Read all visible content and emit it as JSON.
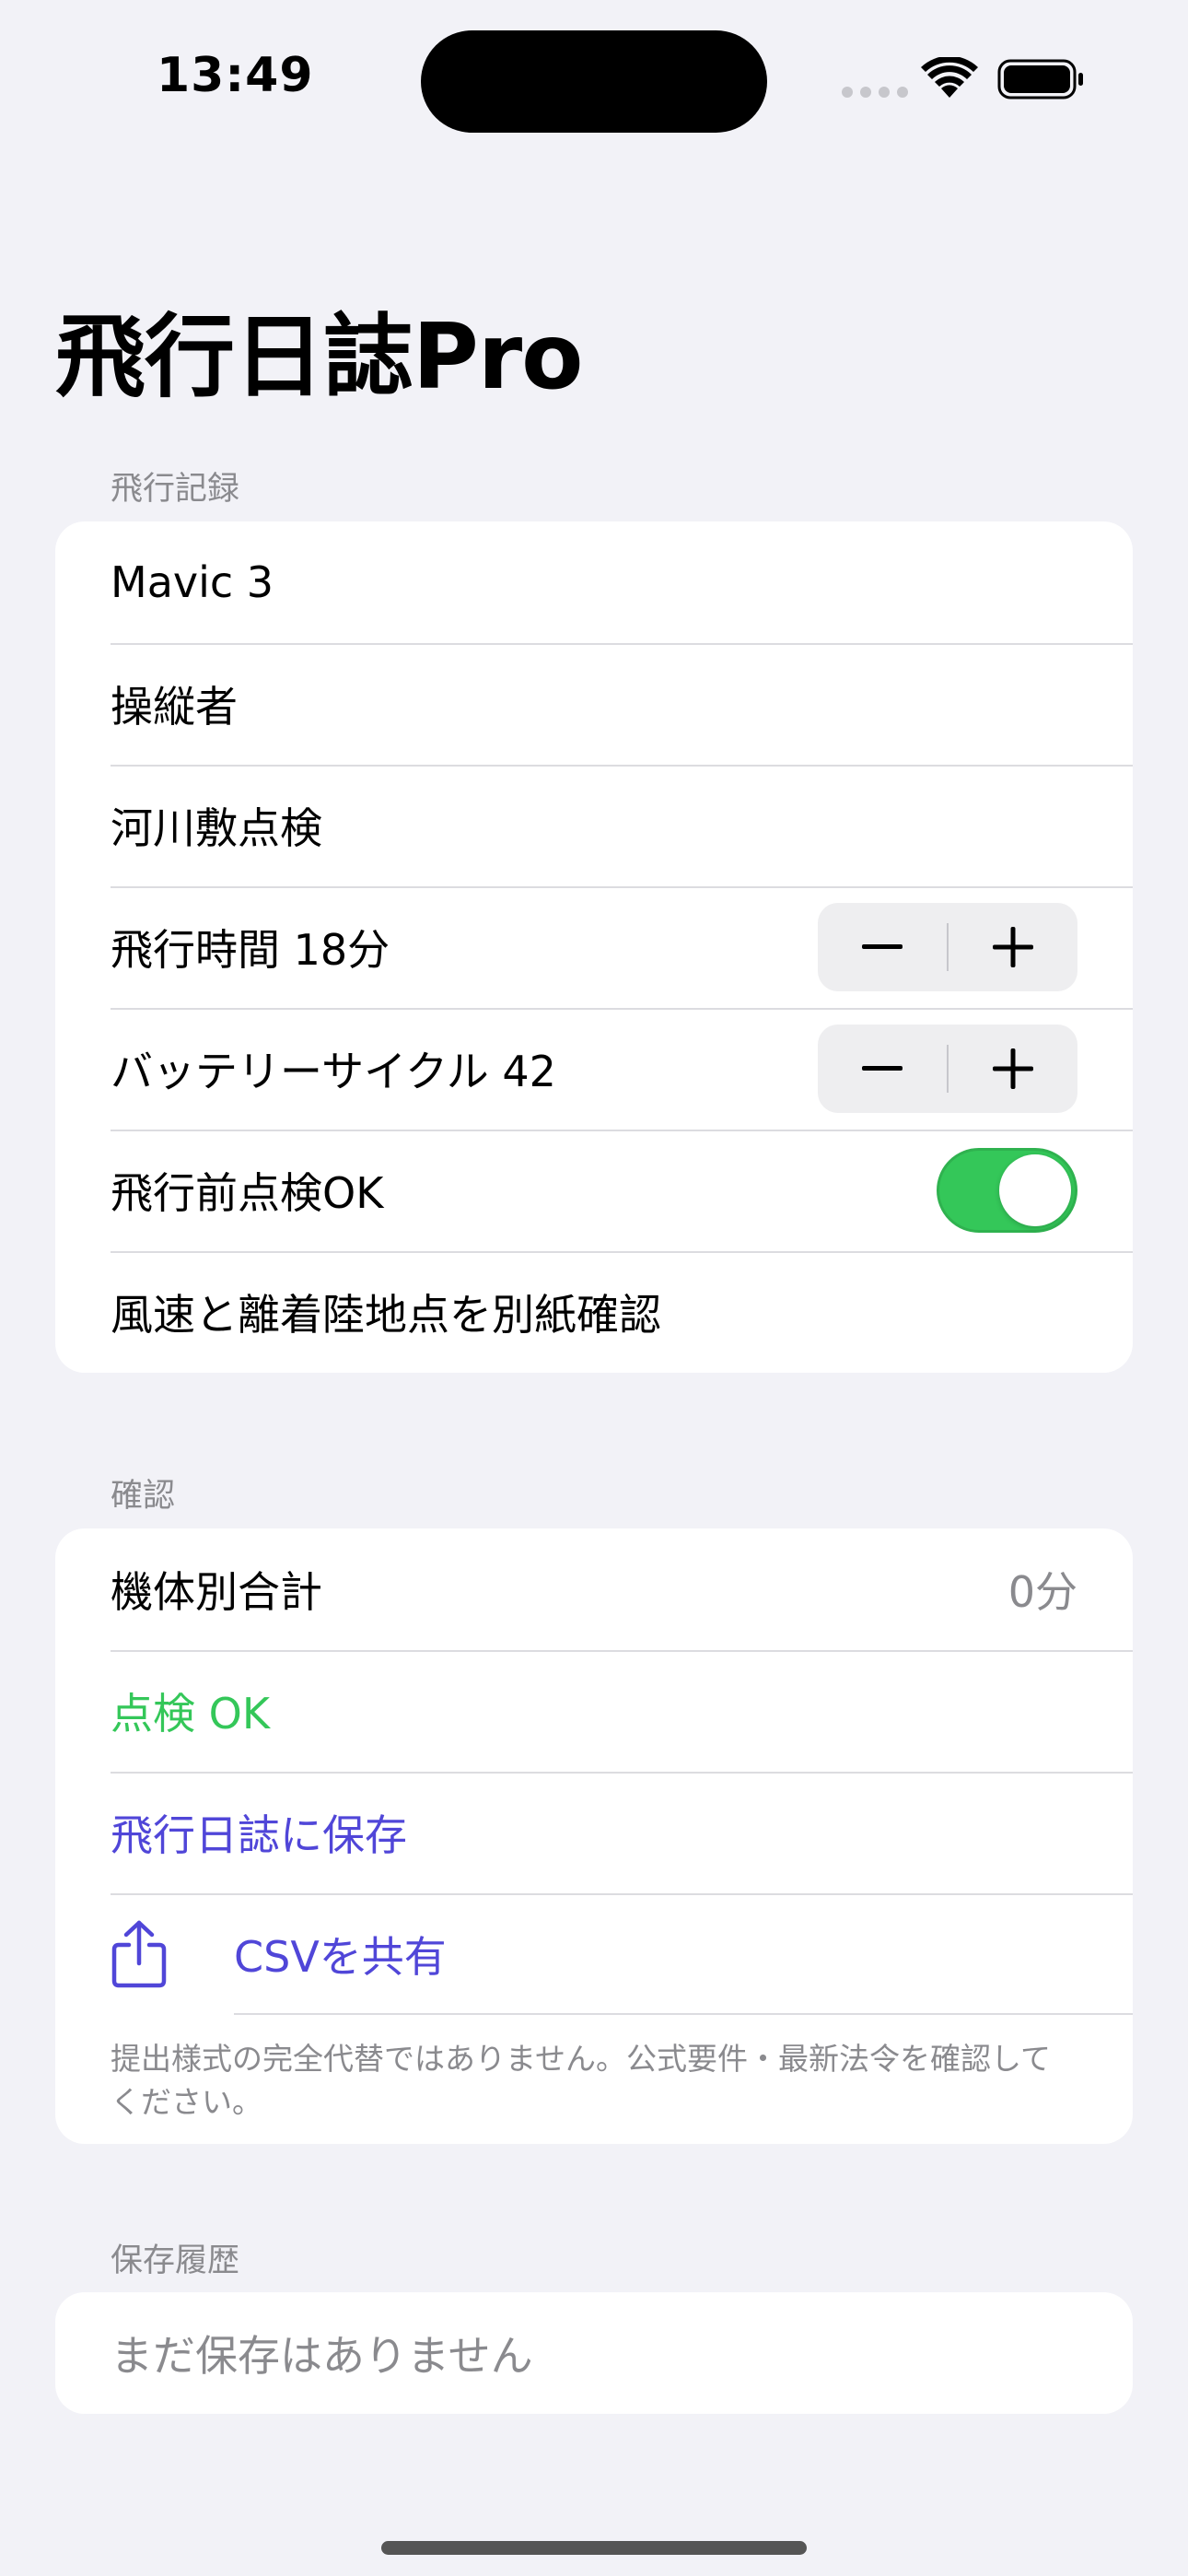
{
  "status_bar": {
    "time": "13:49"
  },
  "title": "飛行日誌Pro",
  "flight_record": {
    "header": "飛行記録",
    "aircraft": "Mavic 3",
    "pilot": "操縦者",
    "location": "河川敷点検",
    "flight_time_label": "飛行時間 18分",
    "battery_cycle_label": "バッテリーサイクル 42",
    "preflight_label": "飛行前点検OK",
    "preflight_on": true,
    "note": "風速と離着陸地点を別紙確認"
  },
  "confirm": {
    "header": "確認",
    "total_label": "機体別合計",
    "total_value": "0分",
    "inspection_status": "点検 OK",
    "save_label": "飛行日誌に保存",
    "share_label": "CSVを共有",
    "footnote": "提出様式の完全代替ではありません。公式要件・最新法令を確認してください。"
  },
  "history": {
    "header": "保存履歴",
    "empty_text": "まだ保存はありません"
  },
  "colors": {
    "background": "#f2f2f7",
    "accent": "#5046d8",
    "toggle_on": "#34c759",
    "secondary_text": "#8a8a8e"
  }
}
